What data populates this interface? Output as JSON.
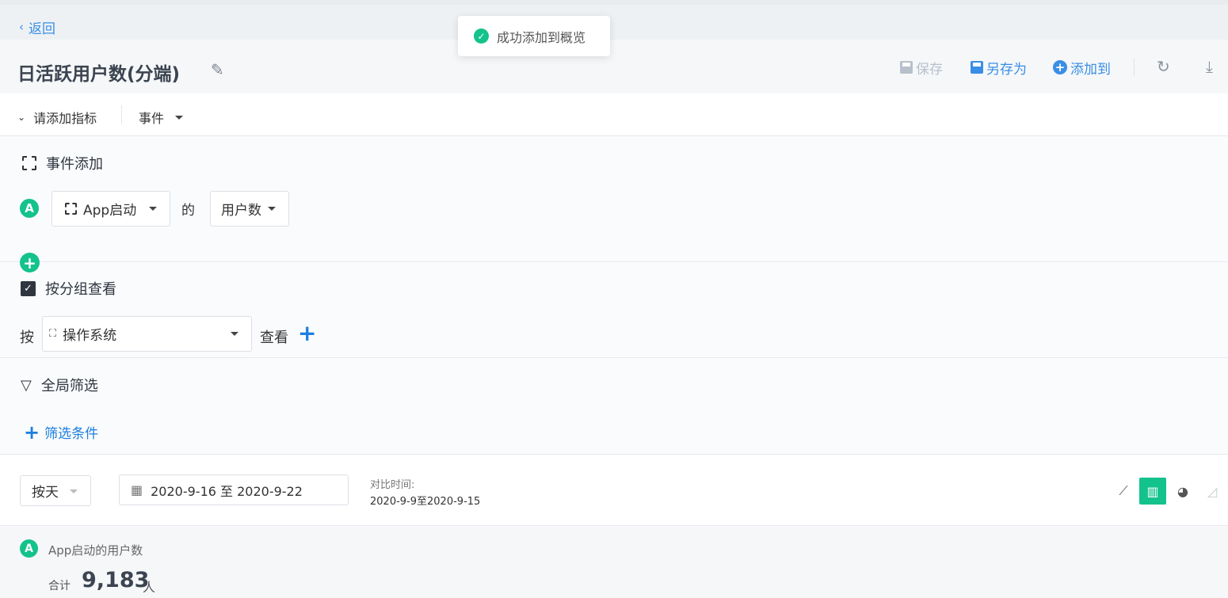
{
  "nav": {
    "back_label": "返回"
  },
  "toast": {
    "message": "成功添加到概览"
  },
  "header": {
    "title": "日活跃用户数(分端)",
    "save_label": "保存",
    "save_as_label": "另存为",
    "add_to_label": "添加到"
  },
  "metric_bar": {
    "toggle_label": "请添加指标",
    "event_type": "事件"
  },
  "event_section": {
    "title": "事件添加",
    "row_letter": "A",
    "event_name": "App启动",
    "connector": "的",
    "measure": "用户数"
  },
  "group_section": {
    "title": "按分组查看",
    "prefix": "按",
    "group_by": "操作系统",
    "suffix": "查看"
  },
  "filter_section": {
    "title": "全局筛选",
    "add_label": "筛选条件"
  },
  "date_bar": {
    "granularity": "按天",
    "date_range": "2020-9-16 至 2020-9-22",
    "compare_label": "对比时间:",
    "compare_range": "2020-9-9至2020-9-15",
    "active_chart": "bar"
  },
  "summary": {
    "letter": "A",
    "metric_name": "App启动的用户数",
    "total_label": "合计",
    "total_value": "9,183",
    "unit": "人"
  },
  "colors": {
    "accent_green": "#14c28b",
    "link_blue": "#3a8ee6"
  }
}
